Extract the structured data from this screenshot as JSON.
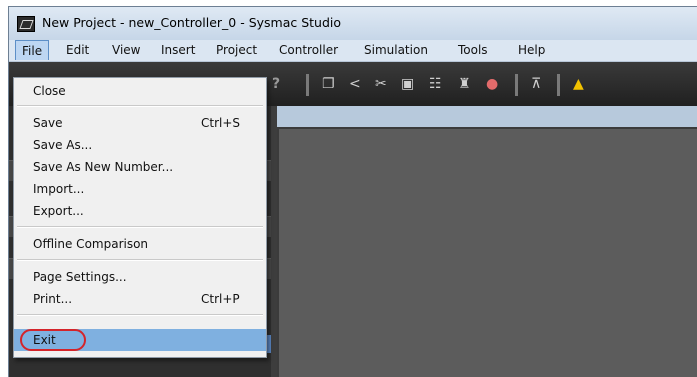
{
  "window": {
    "title": "New Project - new_Controller_0 - Sysmac Studio"
  },
  "menubar": {
    "items": [
      "File",
      "Edit",
      "View",
      "Insert",
      "Project",
      "Controller",
      "Simulation",
      "Tools",
      "Help"
    ]
  },
  "file_menu": {
    "close": "Close",
    "save": "Save",
    "save_shortcut": "Ctrl+S",
    "save_as": "Save As...",
    "save_as_new_number": "Save As New Number...",
    "import": "Import...",
    "export": "Export...",
    "offline_comparison": "Offline Comparison",
    "page_settings": "Page Settings...",
    "print": "Print...",
    "print_shortcut": "Ctrl+P",
    "exit": "Exit"
  },
  "toolbar": {
    "icons": [
      "help-icon",
      "copy-icon",
      "pointer-icon",
      "cut-icon",
      "frame-icon",
      "io-map-icon",
      "find-icon",
      "stop-icon",
      "build-icon",
      "warning-icon"
    ]
  },
  "colors": {
    "menu_highlight": "#7fb0e0",
    "exit_highlight_ring": "#d4242a",
    "warning": "#f2c200"
  }
}
